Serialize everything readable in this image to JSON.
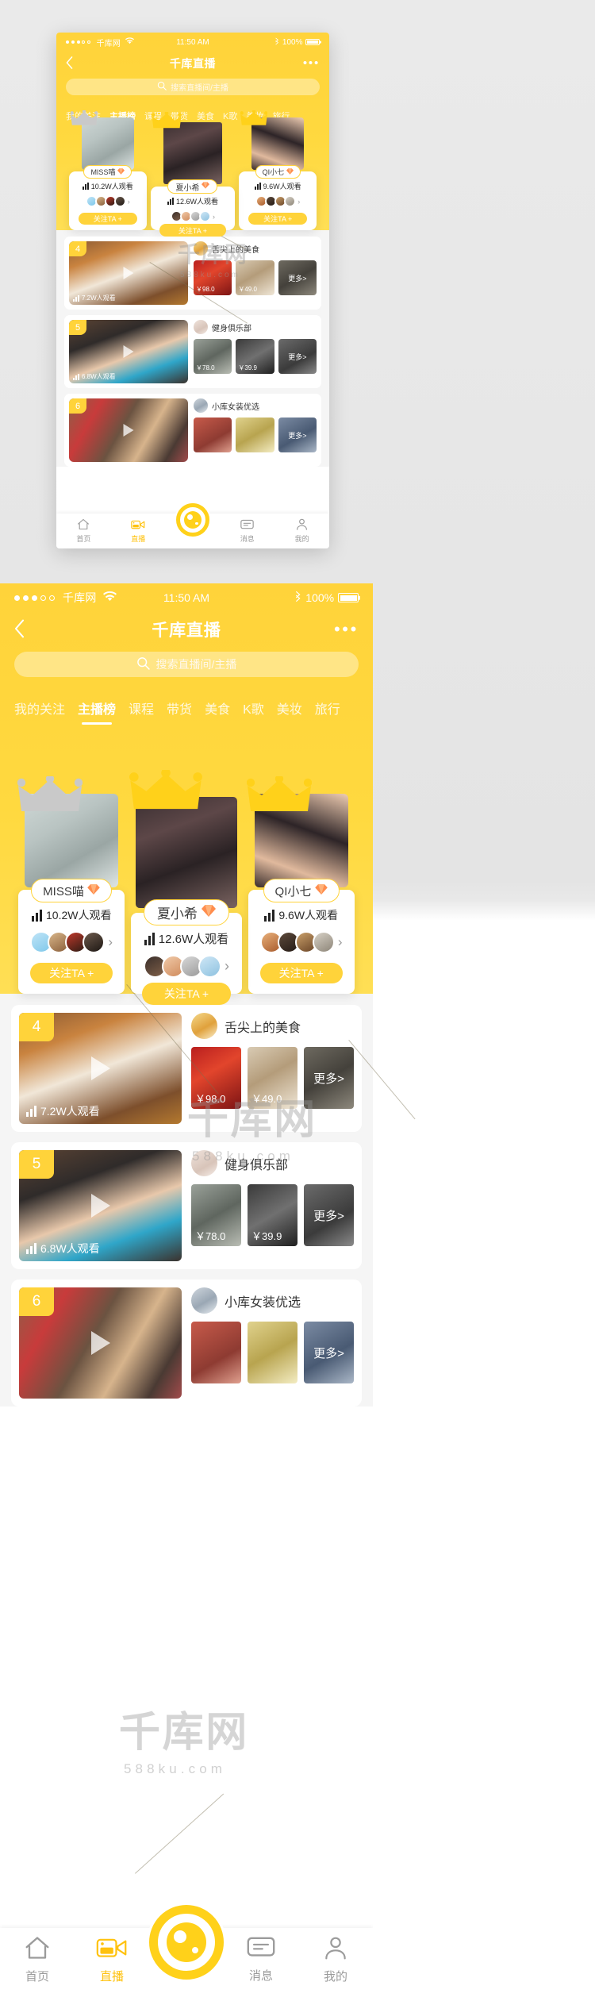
{
  "status_bar": {
    "signal_dots_filled": 3,
    "signal_dots_empty": 2,
    "carrier": "千库网",
    "wifi_icon": "wifi-icon",
    "time": "11:50 AM",
    "bluetooth_icon": "bluetooth-icon",
    "battery_percent": "100%"
  },
  "nav": {
    "back_icon": "chevron-left-icon",
    "title": "千库直播",
    "more_icon": "ellipsis-icon"
  },
  "search": {
    "icon": "search-icon",
    "placeholder": "搜索直播间/主播",
    "value": ""
  },
  "tabs": [
    {
      "label": "我的关注",
      "active": false
    },
    {
      "label": "主播榜",
      "active": true
    },
    {
      "label": "课程",
      "active": false
    },
    {
      "label": "带货",
      "active": false
    },
    {
      "label": "美食",
      "active": false
    },
    {
      "label": "K歌",
      "active": false
    },
    {
      "label": "美妆",
      "active": false
    },
    {
      "label": "旅行",
      "active": false
    }
  ],
  "top_anchors": [
    {
      "rank": 2,
      "crown": "crown-icon-silver",
      "name": "MISS喵",
      "badge_icon": "diamond-badge-icon",
      "viewers": "10.2W人观看",
      "viewers_icon": "bars-icon",
      "fans": [
        "fan-avatar-1",
        "fan-avatar-2",
        "fan-avatar-3",
        "fan-avatar-4"
      ],
      "more_icon": "chevron-right-icon",
      "follow_label": "关注TA +"
    },
    {
      "rank": 1,
      "crown": "crown-icon-gold",
      "name": "夏小希",
      "badge_icon": "diamond-badge-icon",
      "viewers": "12.6W人观看",
      "viewers_icon": "bars-icon",
      "fans": [
        "fan-avatar-1",
        "fan-avatar-2",
        "fan-avatar-3",
        "fan-avatar-4"
      ],
      "more_icon": "chevron-right-icon",
      "follow_label": "关注TA +"
    },
    {
      "rank": 3,
      "crown": "crown-icon-gold",
      "name": "QI小七",
      "badge_icon": "diamond-badge-icon",
      "viewers": "9.6W人观看",
      "viewers_icon": "bars-icon",
      "fans": [
        "fan-avatar-1",
        "fan-avatar-2",
        "fan-avatar-3",
        "fan-avatar-4"
      ],
      "more_icon": "chevron-right-icon",
      "follow_label": "关注TA +"
    }
  ],
  "rows": [
    {
      "rank": "4",
      "viewers": "7.2W人观看",
      "viewers_icon": "bars-icon",
      "play_icon": "play-icon",
      "shop_avatar": "chef-avatar",
      "shop_name": "舌尖上的美食",
      "goods": [
        {
          "price": "￥98.0"
        },
        {
          "price": "￥49.0"
        }
      ],
      "more_label": "更多>"
    },
    {
      "rank": "5",
      "viewers": "6.8W人观看",
      "viewers_icon": "bars-icon",
      "play_icon": "play-icon",
      "shop_avatar": "yoga-avatar",
      "shop_name": "健身俱乐部",
      "goods": [
        {
          "price": "￥78.0"
        },
        {
          "price": "￥39.9"
        }
      ],
      "more_label": "更多>"
    },
    {
      "rank": "6",
      "viewers": "",
      "viewers_icon": "bars-icon",
      "play_icon": "play-icon",
      "shop_avatar": "shop-avatar",
      "shop_name": "小库女装优选",
      "goods": [
        {
          "price": ""
        },
        {
          "price": ""
        }
      ],
      "more_label": "更多>"
    }
  ],
  "tabbar": [
    {
      "label": "首页",
      "icon": "home-icon",
      "active": false
    },
    {
      "label": "直播",
      "icon": "live-cam-icon",
      "active": true
    },
    {
      "label": "消息",
      "icon": "message-icon",
      "active": false
    },
    {
      "label": "我的",
      "icon": "user-icon",
      "active": false
    }
  ],
  "tabbar_center": {
    "icon": "shutter-icon",
    "label": ""
  },
  "watermark": {
    "brand": "千库网",
    "site": "588ku.com"
  },
  "colors": {
    "brand_yellow": "#ffd33a",
    "header_yellow": "#ffd93f",
    "accent": "#ffc20e",
    "text_dark": "#333333",
    "text_muted": "#9b9b9b",
    "white": "#ffffff"
  }
}
